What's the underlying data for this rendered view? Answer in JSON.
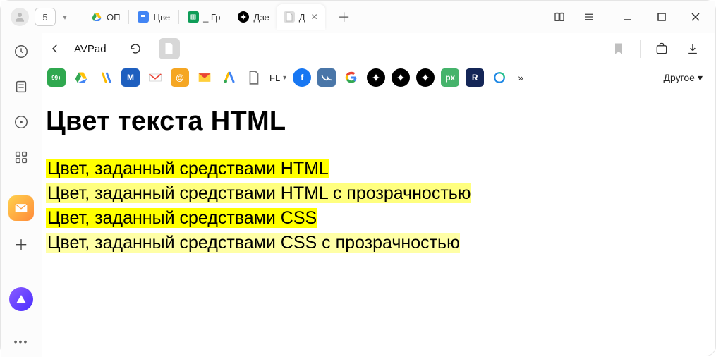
{
  "titlebar": {
    "counter": "5",
    "tabs": [
      {
        "label": "ОП"
      },
      {
        "label": "Цве"
      },
      {
        "label": "_ Гр"
      },
      {
        "label": "Дзе"
      },
      {
        "label": "Д",
        "active": true
      }
    ],
    "shelf_icon": "book-open",
    "menu_icon": "hamburger"
  },
  "address": {
    "title": "AVPad"
  },
  "bookmarks": {
    "fl_label": "FL",
    "other_label": "Другое"
  },
  "page": {
    "heading": "Цвет текста HTML",
    "rows": [
      "Цвет, заданный средствами HTML",
      "Цвет, заданный средствами HTML с прозрачностью",
      "Цвет, заданный средствами CSS",
      "Цвет, заданный средствами CSS с прозрачностью"
    ]
  }
}
